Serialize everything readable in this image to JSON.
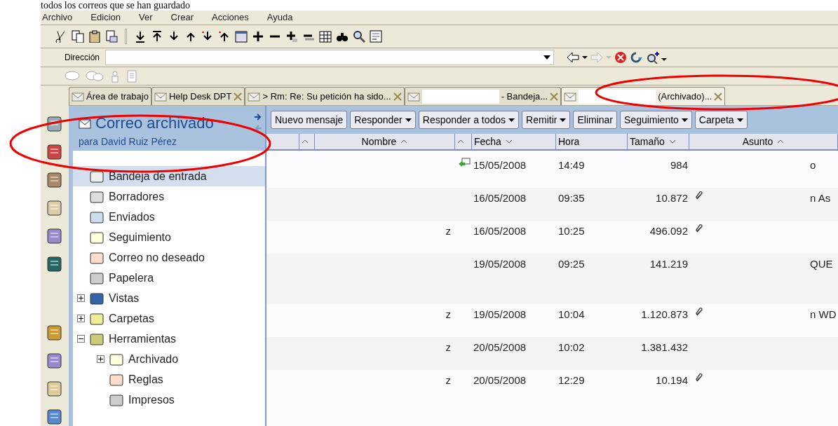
{
  "caption": "todos los correos que se han guardado",
  "menu": [
    "Archivo",
    "Edicion",
    "Ver",
    "Crear",
    "Acciones",
    "Ayuda"
  ],
  "address_bar": {
    "label": "Dirección"
  },
  "tabs": [
    {
      "label": "Área de trabajo",
      "selected": false,
      "closable": false,
      "redacted": false
    },
    {
      "label": "Help Desk DPT",
      "selected": false,
      "closable": true,
      "redacted": false
    },
    {
      "label": "> Rm: Re: Su petición ha sido...",
      "selected": false,
      "closable": true,
      "redacted": false
    },
    {
      "label": "- Bandeja...",
      "selected": false,
      "closable": true,
      "redacted": true
    },
    {
      "label": "(Archivado)...",
      "selected": true,
      "closable": true,
      "redacted": true
    }
  ],
  "panel": {
    "title": "Correo archivado",
    "subtitle": "para David Ruiz Pérez"
  },
  "folders": [
    {
      "label": "Bandeja de entrada",
      "selected": true
    },
    {
      "label": "Borradores",
      "selected": false
    },
    {
      "label": "Enviados",
      "selected": false
    },
    {
      "label": "Seguimiento",
      "selected": false
    },
    {
      "label": "Correo no deseado",
      "selected": false
    },
    {
      "label": "Papelera",
      "selected": false
    },
    {
      "label": "Vistas",
      "selected": false,
      "expanded": false
    },
    {
      "label": "Carpetas",
      "selected": false,
      "expanded": false
    },
    {
      "label": "Herramientas",
      "selected": false,
      "expanded": true,
      "children": [
        {
          "label": "Archivado",
          "selected": false,
          "expanded": false
        },
        {
          "label": "Reglas",
          "selected": false
        },
        {
          "label": "Impresos",
          "selected": false
        }
      ]
    }
  ],
  "actions": [
    {
      "label": "Nuevo mensaje",
      "dropdown": false
    },
    {
      "label": "Responder",
      "dropdown": true
    },
    {
      "label": "Responder a todos",
      "dropdown": true
    },
    {
      "label": "Remitir",
      "dropdown": true
    },
    {
      "label": "Eliminar",
      "dropdown": false
    },
    {
      "label": "Seguimiento",
      "dropdown": true
    },
    {
      "label": "Carpeta",
      "dropdown": true
    }
  ],
  "columns": [
    {},
    {
      "sort_ascending": true
    },
    {
      "label": "Nombre",
      "sort_ascending": true
    },
    {
      "sort_ascending": true
    },
    {
      "label": "Fecha",
      "sort_ascending": false
    },
    {
      "label": "Hora"
    },
    {
      "label": "Tamaño",
      "sort_ascending": false
    },
    {
      "label": "Asunto",
      "sort_ascending": true
    }
  ],
  "rows": [
    {
      "replied": true,
      "fecha": "15/05/2008",
      "hora": "14:49",
      "tamano": "984",
      "attachment": false,
      "asunto": "o",
      "tall": false
    },
    {
      "replied": false,
      "fecha": "16/05/2008",
      "hora": "09:35",
      "tamano": "10.872",
      "attachment": true,
      "asunto": "n As",
      "tall": false
    },
    {
      "nombre": "z",
      "replied": false,
      "fecha": "16/05/2008",
      "hora": "10:25",
      "tamano": "496.092",
      "attachment": true,
      "tall": false
    },
    {
      "replied": false,
      "fecha": "19/05/2008",
      "hora": "09:25",
      "tamano": "141.219",
      "attachment": false,
      "asunto": "QUE",
      "tall": true
    },
    {
      "nombre": "z",
      "replied": false,
      "fecha": "19/05/2008",
      "hora": "10:04",
      "tamano": "1.120.873",
      "attachment": true,
      "asunto": "n WD",
      "tall": false
    },
    {
      "nombre": "z",
      "replied": false,
      "fecha": "20/05/2008",
      "hora": "10:02",
      "tamano": "1.381.432",
      "attachment": false,
      "tall": false
    },
    {
      "nombre": "z",
      "replied": false,
      "fecha": "20/05/2008",
      "hora": "12:29",
      "tamano": "10.194",
      "attachment": true,
      "tall": false
    }
  ]
}
